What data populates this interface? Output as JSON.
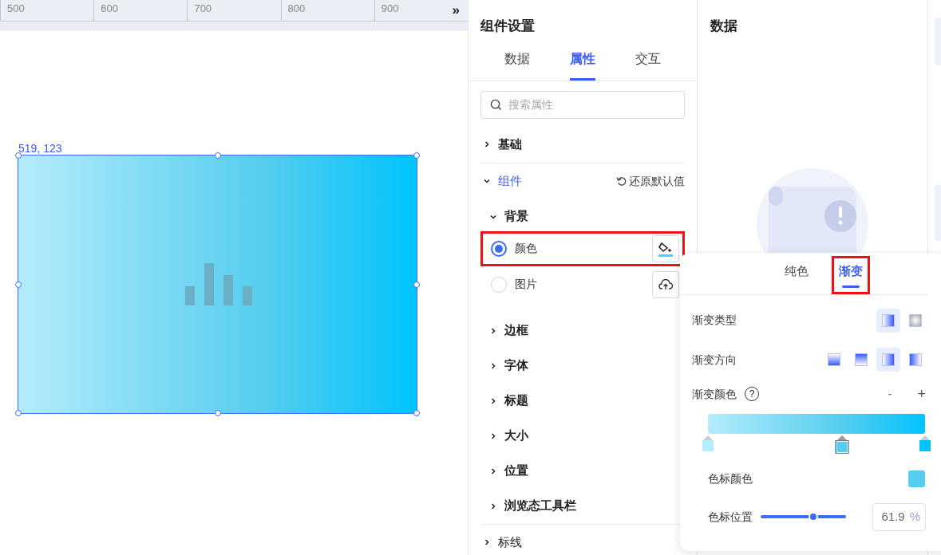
{
  "ruler": {
    "ticks": [
      "500",
      "600",
      "700",
      "800",
      "900"
    ],
    "more": "»"
  },
  "canvas": {
    "position_label": "519, 123"
  },
  "settings": {
    "title": "组件设置",
    "tabs": [
      {
        "label": "数据",
        "selected": false
      },
      {
        "label": "属性",
        "selected": true
      },
      {
        "label": "交互",
        "selected": false
      }
    ],
    "search": {
      "placeholder": "搜索属性"
    },
    "sections": [
      {
        "label": "基础",
        "expanded": false,
        "active": false
      },
      {
        "label": "组件",
        "expanded": true,
        "active": true,
        "action": "还原默认值",
        "children": [
          {
            "label": "背景",
            "expanded": true,
            "options": [
              {
                "label": "颜色",
                "selected": true,
                "highlighted": true,
                "kind": "paint"
              },
              {
                "label": "图片",
                "selected": false,
                "highlighted": false,
                "kind": "upload"
              }
            ]
          },
          {
            "label": "边框",
            "expanded": false
          },
          {
            "label": "字体",
            "expanded": false
          },
          {
            "label": "标题",
            "expanded": false
          },
          {
            "label": "大小",
            "expanded": false
          },
          {
            "label": "位置",
            "expanded": false
          },
          {
            "label": "浏览态工具栏",
            "expanded": false
          }
        ]
      },
      {
        "label": "标线",
        "expanded": false,
        "active": false
      }
    ]
  },
  "data_panel": {
    "title": "数据"
  },
  "popover": {
    "tabs": [
      {
        "label": "纯色",
        "selected": false,
        "highlighted": false
      },
      {
        "label": "渐变",
        "selected": true,
        "highlighted": true
      }
    ],
    "type_row": {
      "label": "渐变类型",
      "options": [
        {
          "kind": "linear",
          "selected": true
        },
        {
          "kind": "radial",
          "selected": false
        }
      ]
    },
    "direction_row": {
      "label": "渐变方向",
      "options": [
        {
          "kind": "to-top",
          "selected": false
        },
        {
          "kind": "to-bottom",
          "selected": false
        },
        {
          "kind": "to-right",
          "selected": true
        },
        {
          "kind": "to-left",
          "selected": false
        }
      ]
    },
    "colors_row": {
      "label": "渐变颜色",
      "help": "?",
      "remove": "-",
      "add": "+"
    },
    "stops": [
      {
        "color": "#b3ecfb",
        "level": 0,
        "selected": false
      },
      {
        "color": "#55cdee",
        "level": 0.619,
        "selected": true
      },
      {
        "color": "#00c3fd",
        "level": 1,
        "selected": false
      }
    ],
    "stop_color": {
      "label": "色标颜色",
      "color": "#55cdee"
    },
    "stop_position": {
      "label": "色标位置",
      "level": 0.619,
      "value": "61.9",
      "unit": "%"
    }
  }
}
